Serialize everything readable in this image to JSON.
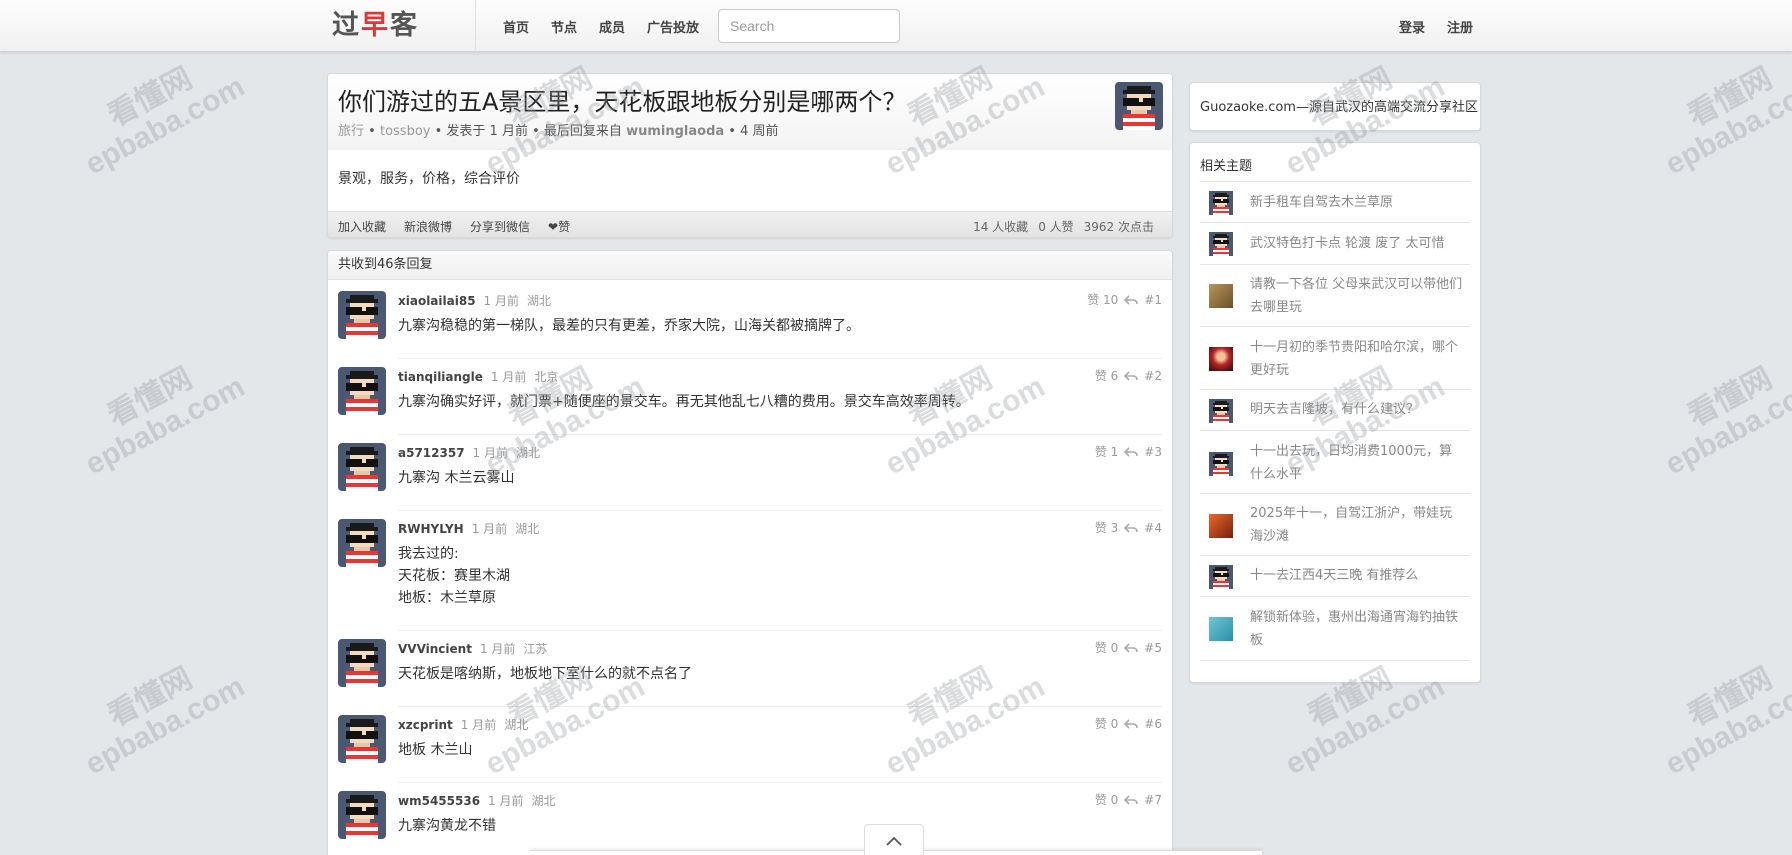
{
  "navbar": {
    "logo_parts": [
      "过",
      "早",
      "客"
    ],
    "links": [
      "首页",
      "节点",
      "成员",
      "广告投放"
    ],
    "search_placeholder": "Search",
    "login": "登录",
    "register": "注册"
  },
  "watermark": {
    "cn": "看懂网",
    "en": "epbaba.com"
  },
  "topic": {
    "title": "你们游过的五A景区里，天花板跟地板分别是哪两个？",
    "node": "旅行",
    "author": "tossboy",
    "posted": "发表于 1 月前",
    "last_reply_prefix": "最后回复来自",
    "last_reply_user": "wuminglaoda",
    "last_reply_time": "4 周前",
    "sep": "•",
    "body": "景观，服务，价格，综合评价",
    "actions": [
      "加入收藏",
      "新浪微博",
      "分享到微信",
      "❤赞"
    ],
    "stats": [
      "14 人收藏",
      "0 人赞",
      "3962 次点击"
    ]
  },
  "replies": {
    "header": "共收到46条回复",
    "items": [
      {
        "user": "xiaolailai85",
        "time": "1 月前",
        "location": "湖北",
        "text": "九寨沟稳稳的第一梯队，最差的只有更差，乔家大院，山海关都被摘牌了。",
        "likes": "赞 10",
        "floor": "#1"
      },
      {
        "user": "tianqiliangle",
        "time": "1 月前",
        "location": "北京",
        "text": "九寨沟确实好评，就门票+随便座的景交车。再无其他乱七八糟的费用。景交车高效率周转。",
        "likes": "赞 6",
        "floor": "#2"
      },
      {
        "user": "a5712357",
        "time": "1 月前",
        "location": "湖北",
        "text": "九寨沟 木兰云雾山",
        "likes": "赞 1",
        "floor": "#3"
      },
      {
        "user": "RWHYLYH",
        "time": "1 月前",
        "location": "湖北",
        "text": "我去过的:\n天花板：赛里木湖\n地板：木兰草原",
        "likes": "赞 3",
        "floor": "#4"
      },
      {
        "user": "VVVincient",
        "time": "1 月前",
        "location": "江苏",
        "text": "天花板是喀纳斯，地板地下室什么的就不点名了",
        "likes": "赞 0",
        "floor": "#5"
      },
      {
        "user": "xzcprint",
        "time": "1 月前",
        "location": "湖北",
        "text": "地板 木兰山",
        "likes": "赞 0",
        "floor": "#6"
      },
      {
        "user": "wm5455536",
        "time": "1 月前",
        "location": "湖北",
        "text": "九寨沟黄龙不错",
        "likes": "赞 0",
        "floor": "#7"
      }
    ]
  },
  "sidebar": {
    "info": "Guozaoke.com—源自武汉的高端交流分享社区",
    "related_title": "相关主题",
    "related": [
      {
        "text": "新手租车自驾去木兰草原",
        "thumb": "pixel-avatar"
      },
      {
        "text": "武汉特色打卡点 轮渡 废了 太可惜",
        "thumb": "pixel-avatar"
      },
      {
        "text": "请教一下各位 父母来武汉可以带他们去哪里玩",
        "thumb": "photo-avatar-brown"
      },
      {
        "text": "十一月初的季节贵阳和哈尔滨，哪个更好玩",
        "thumb": "photo-avatar-red"
      },
      {
        "text": "明天去吉隆坡，有什么建议？",
        "thumb": "pixel-avatar"
      },
      {
        "text": "十一出去玩，日均消费1000元，算什么水平",
        "thumb": "pixel-avatar"
      },
      {
        "text": "2025年十一，自驾江浙沪，带娃玩海沙滩",
        "thumb": "photo-avatar-orange"
      },
      {
        "text": "十一去江西4天三晚 有推荐么",
        "thumb": "pixel-avatar"
      },
      {
        "text": "解锁新体验，惠州出海通宵海钓抽铁板",
        "thumb": "photo-avatar-teal"
      }
    ]
  },
  "colors": {
    "logo_accent": "#d83a3a",
    "background": "#e4e7ea",
    "link_muted": "#999999"
  }
}
